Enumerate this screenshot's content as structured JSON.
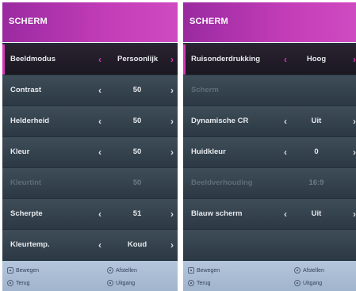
{
  "left_panel": {
    "title": "SCHERM",
    "rows": [
      {
        "label": "Beeldmodus",
        "value": "Persoonlijk",
        "state": "selected",
        "arrows": true
      },
      {
        "label": "Contrast",
        "value": "50",
        "state": "normal",
        "arrows": true
      },
      {
        "label": "Helderheid",
        "value": "50",
        "state": "normal",
        "arrows": true
      },
      {
        "label": "Kleur",
        "value": "50",
        "state": "normal",
        "arrows": true
      },
      {
        "label": "Kleurtint",
        "value": "50",
        "state": "disabled",
        "arrows": false
      },
      {
        "label": "Scherpte",
        "value": "51",
        "state": "normal",
        "arrows": true
      },
      {
        "label": "Kleurtemp.",
        "value": "Koud",
        "state": "normal",
        "arrows": true
      }
    ],
    "footer": {
      "move": "Bewegen",
      "adjust": "Afstellen",
      "back": "Terug",
      "exit": "Uitgang"
    }
  },
  "right_panel": {
    "title": "SCHERM",
    "rows": [
      {
        "label": "Ruisonderdrukking",
        "value": "Hoog",
        "state": "selected",
        "arrows": true
      },
      {
        "label": "Scherm",
        "value": "",
        "state": "disabled",
        "arrows": false
      },
      {
        "label": "Dynamische CR",
        "value": "Uit",
        "state": "normal",
        "arrows": true
      },
      {
        "label": "Huidkleur",
        "value": "0",
        "state": "normal",
        "arrows": true
      },
      {
        "label": "Beeldverhouding",
        "value": "16:9",
        "state": "disabled",
        "arrows": false
      },
      {
        "label": "Blauw scherm",
        "value": "Uit",
        "state": "normal",
        "arrows": true
      },
      {
        "label": "",
        "value": "",
        "state": "empty",
        "arrows": false
      }
    ],
    "footer": {
      "move": "Bewegen",
      "adjust": "Afstellen",
      "back": "Terug",
      "exit": "Uitgang"
    }
  },
  "arrows": {
    "left": "‹",
    "right": "›"
  },
  "colors": {
    "accent": "#d338b8",
    "header": "#c33db8",
    "panel": "#23313c",
    "footer": "#b4c6dc"
  }
}
